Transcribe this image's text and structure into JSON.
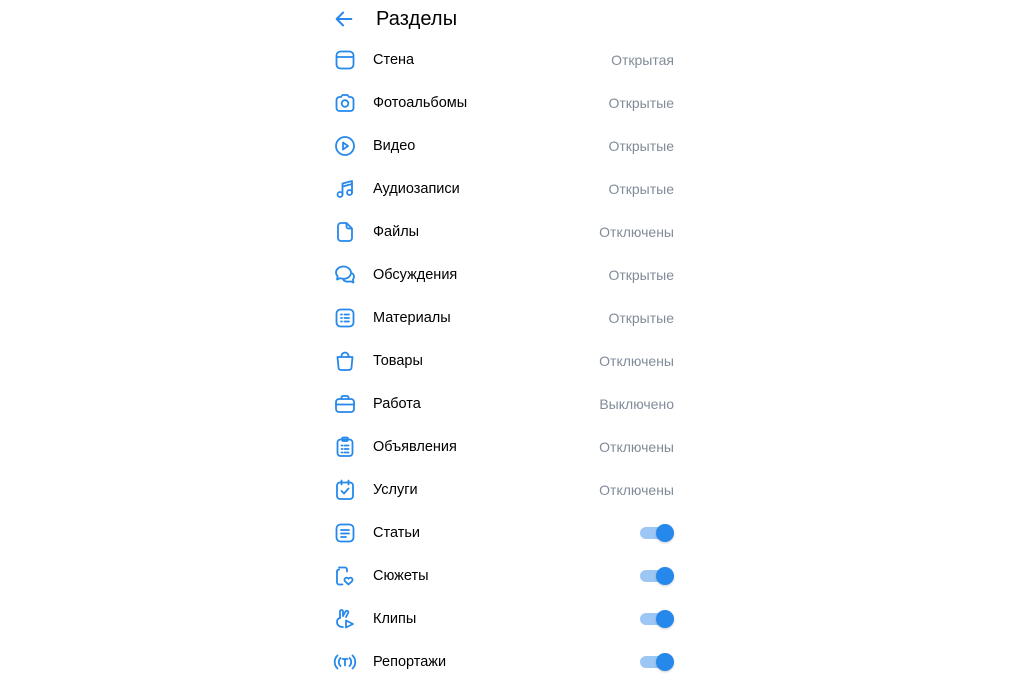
{
  "header": {
    "title": "Разделы"
  },
  "colors": {
    "accent": "#2688eb",
    "secondary_text": "#818c99",
    "toggle_track": "#9cc6f3"
  },
  "sections": [
    {
      "label": "Стена",
      "value": "Открытая",
      "icon": "wall-icon"
    },
    {
      "label": "Фотоальбомы",
      "value": "Открытые",
      "icon": "camera-icon"
    },
    {
      "label": "Видео",
      "value": "Открытые",
      "icon": "video-play-icon"
    },
    {
      "label": "Аудиозаписи",
      "value": "Открытые",
      "icon": "music-icon"
    },
    {
      "label": "Файлы",
      "value": "Отключены",
      "icon": "file-icon"
    },
    {
      "label": "Обсуждения",
      "value": "Открытые",
      "icon": "discussions-icon"
    },
    {
      "label": "Материалы",
      "value": "Открытые",
      "icon": "materials-icon"
    },
    {
      "label": "Товары",
      "value": "Отключены",
      "icon": "shopping-bag-icon"
    },
    {
      "label": "Работа",
      "value": "Выключено",
      "icon": "briefcase-icon"
    },
    {
      "label": "Объявления",
      "value": "Отключены",
      "icon": "clipboard-list-icon"
    },
    {
      "label": "Услуги",
      "value": "Отключены",
      "icon": "calendar-check-icon"
    },
    {
      "label": "Статьи",
      "toggle": true,
      "icon": "article-icon"
    },
    {
      "label": "Сюжеты",
      "toggle": true,
      "icon": "stories-icon"
    },
    {
      "label": "Клипы",
      "toggle": true,
      "icon": "clips-icon"
    },
    {
      "label": "Репортажи",
      "toggle": true,
      "icon": "broadcast-icon"
    }
  ]
}
